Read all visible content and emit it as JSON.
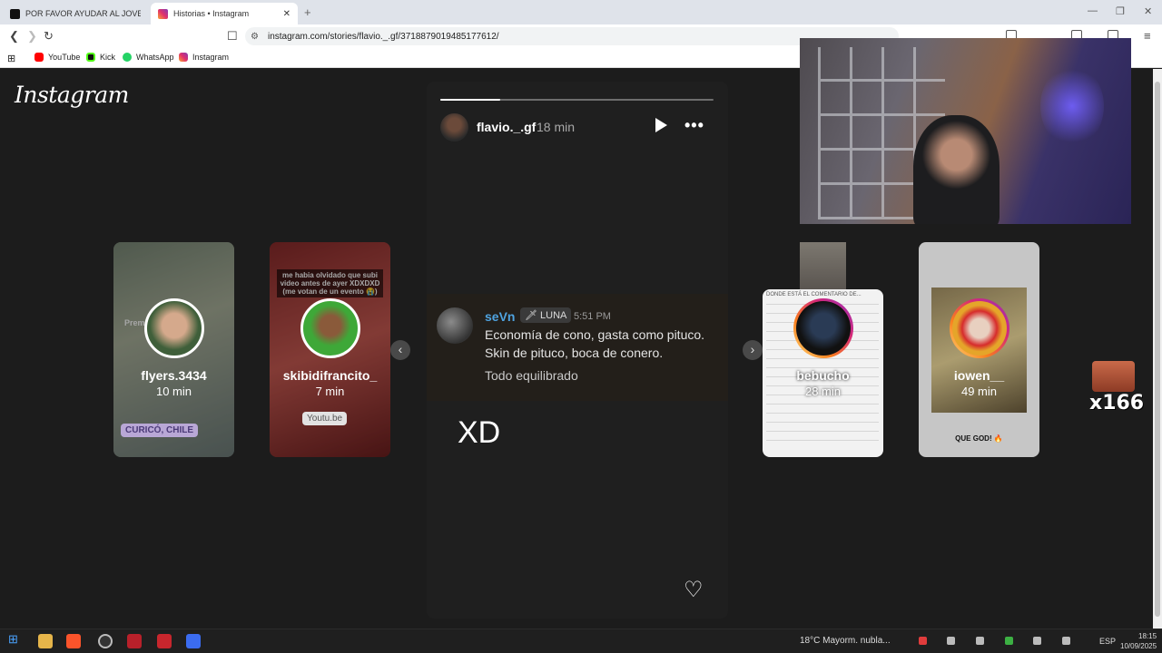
{
  "browser": {
    "tabs": [
      {
        "title": "POR FAVOR AYUDAR AL JOVEN SI AL"
      },
      {
        "title": "Historias • Instagram"
      }
    ],
    "new_tab": "+",
    "url": "instagram.com/stories/flavio._.gf/3718879019485177612/",
    "bookmarks": [
      "YouTube",
      "Kick",
      "WhatsApp",
      "Instagram"
    ]
  },
  "instagram": {
    "logo": "Instagram",
    "side_stories": [
      {
        "user": "flyers.3434",
        "time": "10 min",
        "chip": "CURICÓ, CHILE",
        "overlay": "Prem"
      },
      {
        "user": "skibidifrancito_",
        "time": "7 min",
        "caption": "me habia olvidado que subi video antes de ayer XDXDXD (me votan de un evento 😭)",
        "chip": "Youtu.be"
      },
      {
        "user": "bebucho",
        "time": "28 min",
        "caption": "DONDE ESTÁ EL COMENTARIO DE..."
      },
      {
        "user": "iowen__",
        "time": "49 min",
        "caption": "QUE GOD! 🔥"
      }
    ],
    "story": {
      "user": "flavio._.gf",
      "time": "18 min",
      "progress": 0.22,
      "discord": {
        "name": "seVn",
        "tag": "LUNA",
        "time": "5:51 PM",
        "line1": "Economía de cono, gasta como pituco.",
        "line2": "Skin de pituco, boca de conero.",
        "line3": "Todo equilibrado"
      },
      "caption": "XD"
    }
  },
  "overlay": {
    "emote_count": "x166"
  },
  "taskbar": {
    "weather": "18°C  Mayorm. nubla...",
    "lang": "ESP",
    "time": "18:15",
    "date": "10/09/2025"
  }
}
